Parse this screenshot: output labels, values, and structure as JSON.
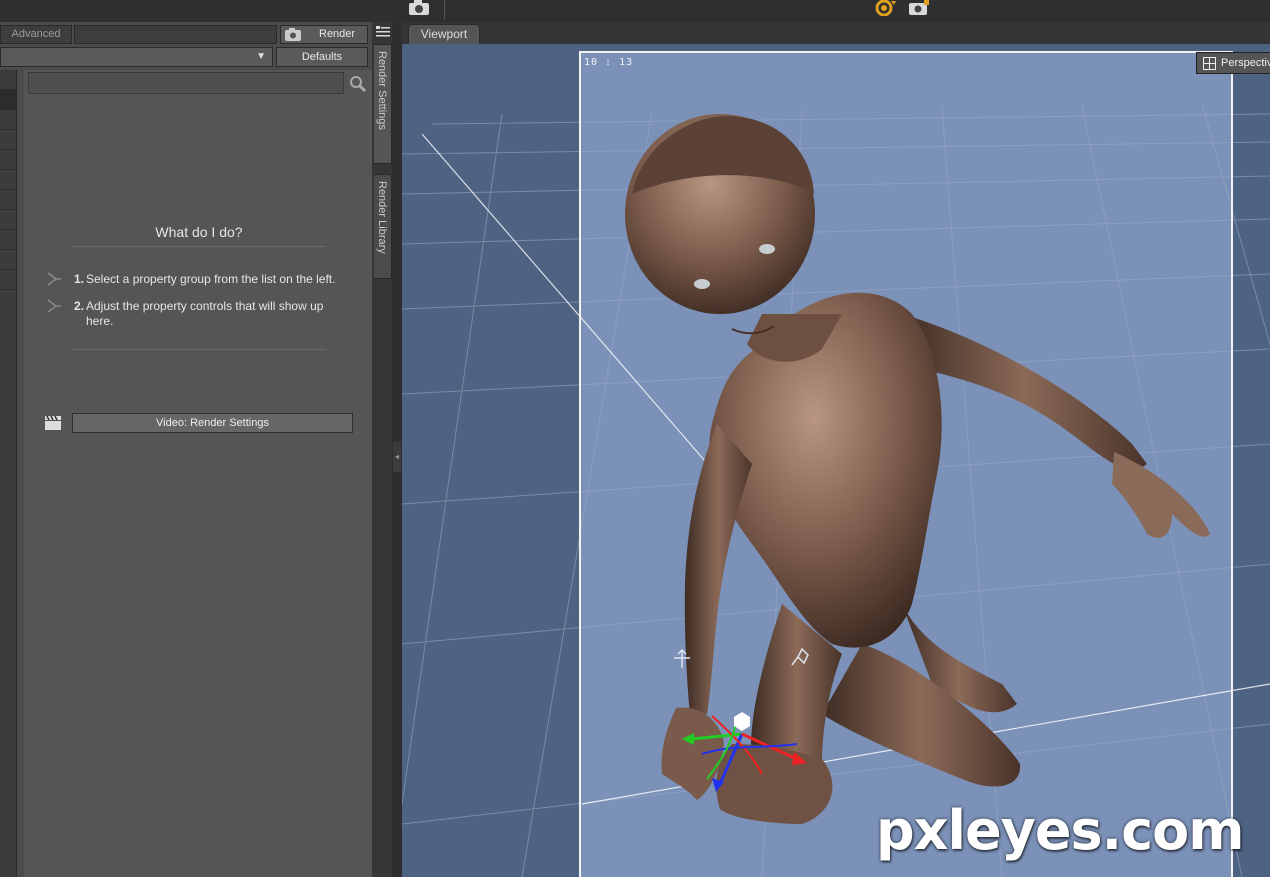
{
  "pane_tabs": {
    "advanced": "Advanced",
    "render": "Render",
    "defaults": "Defaults"
  },
  "help": {
    "title": "What do I do?",
    "steps": [
      {
        "num": "1.",
        "text": "Select a property group from the list on the left."
      },
      {
        "num": "2.",
        "text": "Adjust the property controls that will show up here."
      }
    ],
    "video_button": "Video: Render Settings"
  },
  "side_tabs": {
    "render_settings": "Render Settings",
    "render_library": "Render Library"
  },
  "viewport": {
    "tab": "Viewport",
    "frame_label": "10 : 13",
    "camera_button": "Perspective",
    "background_color": "#4e6382",
    "render_frame_color": "#7b91b8",
    "watermark": "pxleyes.com"
  },
  "icons": {
    "top_camera": "camera-icon",
    "top_render": "render-spin-icon",
    "search": "search-icon",
    "step": "property-hint-icon",
    "video": "clapperboard-icon",
    "panel_menu": "menu-lines-icon",
    "perspective": "perspective-grid-icon"
  }
}
